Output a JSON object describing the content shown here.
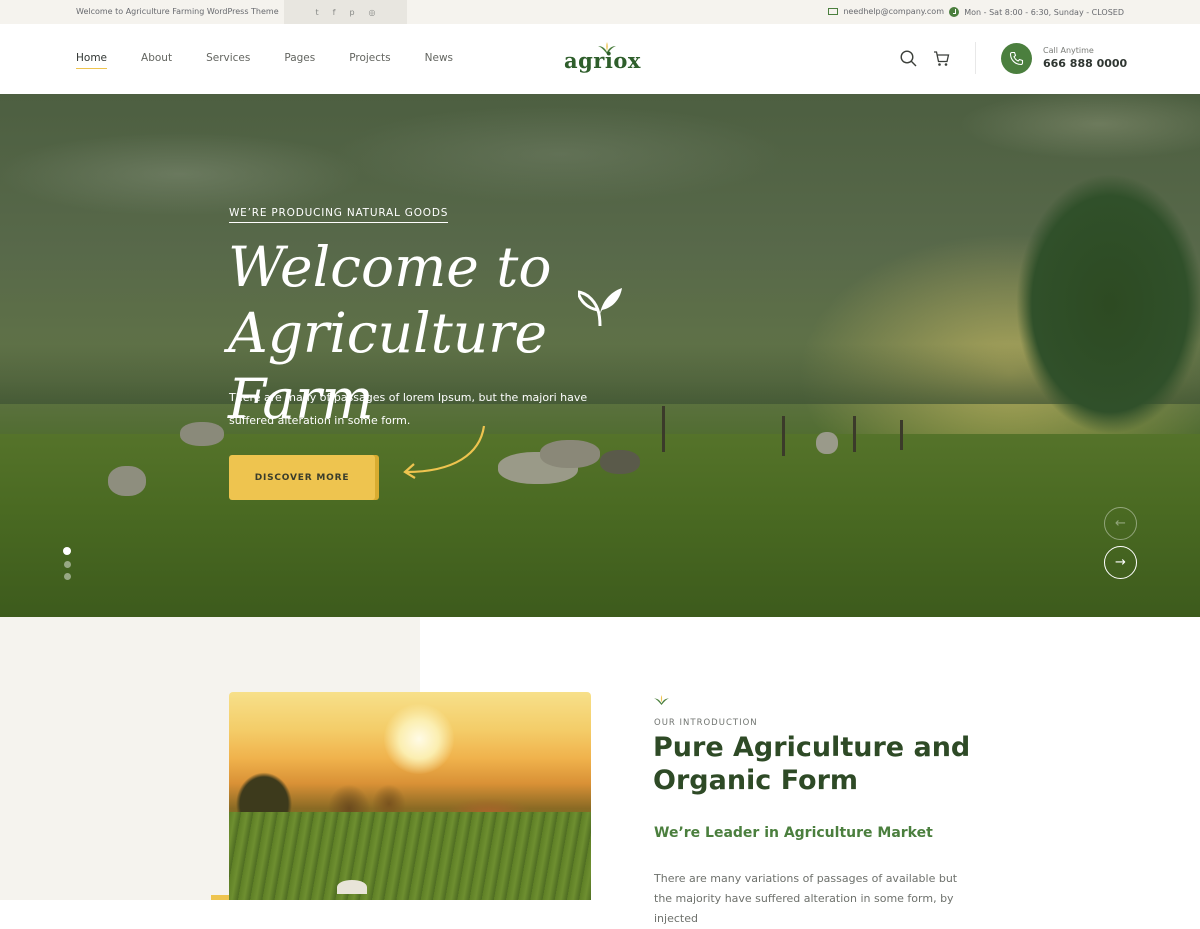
{
  "topbar": {
    "welcome": "Welcome to Agriculture Farming WordPress Theme",
    "social_icons": [
      "twitter-icon",
      "facebook-icon",
      "pinterest-icon",
      "instagram-icon"
    ],
    "social_glyphs": [
      "t",
      "f",
      "p",
      "◎"
    ],
    "email": "needhelp@company.com",
    "hours": "Mon - Sat 8:00 - 6:30, Sunday - CLOSED"
  },
  "header": {
    "nav": [
      {
        "label": "Home",
        "active": true
      },
      {
        "label": "About"
      },
      {
        "label": "Services"
      },
      {
        "label": "Pages"
      },
      {
        "label": "Projects"
      },
      {
        "label": "News"
      }
    ],
    "logo": "agriox",
    "call_label": "Call Anytime",
    "call_number": "666 888 0000"
  },
  "hero": {
    "tag": "WE’RE PRODUCING NATURAL GOODS",
    "title_line1": "Welcome to",
    "title_line2": "Agriculture Farm",
    "text": "There are many of passages of lorem Ipsum, but the majori have suffered alteration in some form.",
    "button": "DISCOVER MORE",
    "slide_prev": "←",
    "slide_next": "→",
    "slide_count": 3,
    "slide_active": 1
  },
  "intro": {
    "tag": "OUR INTRODUCTION",
    "title": "Pure Agriculture and Organic Form",
    "subtitle": "We’re Leader in Agriculture Market",
    "text": "There are many variations of passages of available but the majority have suffered alteration in some form, by injected"
  },
  "colors": {
    "brand_green": "#4b7f3e",
    "accent_yellow": "#eec44f",
    "dark_green": "#2e4a26",
    "topbar_bg": "#f5f3ee"
  }
}
